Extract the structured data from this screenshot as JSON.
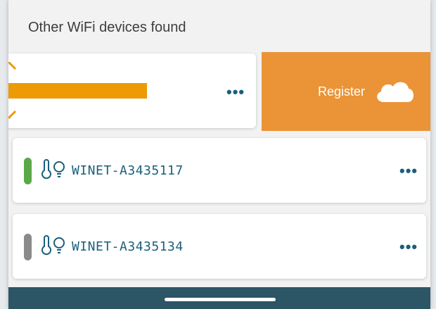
{
  "header": {
    "title": "Other WiFi devices found"
  },
  "swipe_action": {
    "register_label": "Register",
    "icon": "cloud-icon",
    "color": "#ea9337"
  },
  "devices": [
    {
      "name": "WINET-A3435117",
      "status_color": "#5aa84a",
      "icons": "thermometer-bulb-icon"
    },
    {
      "name": "WINET-A3435134",
      "status_color": "#8a8a8a",
      "icons": "thermometer-bulb-icon"
    }
  ],
  "more_glyph": "•••",
  "colors": {
    "accent": "#1a5f7a",
    "bottom_bar": "#2c5566"
  }
}
